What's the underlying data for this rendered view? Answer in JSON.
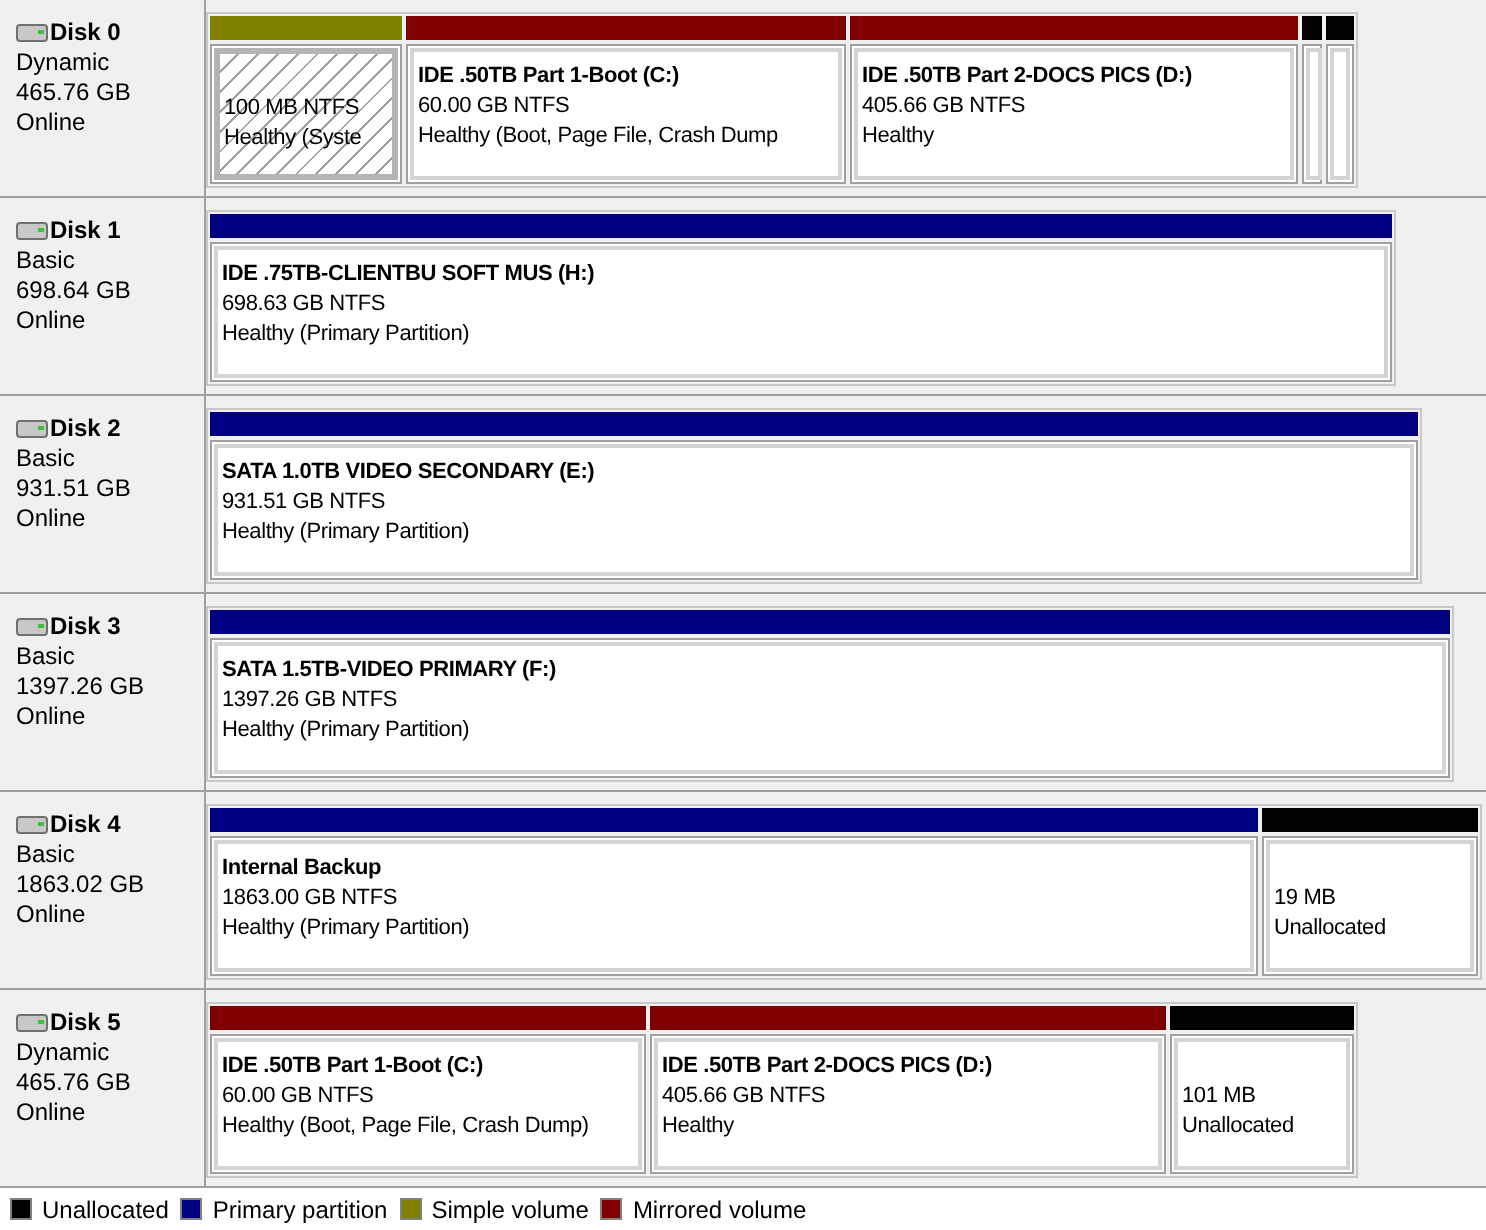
{
  "disks": [
    {
      "name": "Disk 0",
      "type": "Dynamic",
      "size": "465.76 GB",
      "status": "Online",
      "partitions": [
        {
          "kind": "simple",
          "selected": true,
          "lines": [
            "100 MB NTFS",
            "Healthy (Syste"
          ]
        },
        {
          "kind": "mirrored",
          "selected": false,
          "title": "IDE .50TB Part 1-Boot  (C:)",
          "lines": [
            "60.00 GB NTFS",
            "Healthy (Boot, Page File, Crash Dump"
          ]
        },
        {
          "kind": "mirrored",
          "selected": false,
          "title": "IDE .50TB Part 2-DOCS PICS  (D:)",
          "lines": [
            "405.66 GB NTFS",
            "Healthy"
          ]
        },
        {
          "kind": "unallocated",
          "selected": false
        },
        {
          "kind": "unallocated",
          "selected": false
        }
      ]
    },
    {
      "name": "Disk 1",
      "type": "Basic",
      "size": "698.64 GB",
      "status": "Online",
      "partitions": [
        {
          "kind": "primary",
          "selected": false,
          "title": "IDE .75TB-CLIENTBU SOFT MUS  (H:)",
          "lines": [
            "698.63 GB NTFS",
            "Healthy (Primary Partition)"
          ]
        }
      ]
    },
    {
      "name": "Disk 2",
      "type": "Basic",
      "size": "931.51 GB",
      "status": "Online",
      "partitions": [
        {
          "kind": "primary",
          "selected": false,
          "title": "SATA 1.0TB VIDEO SECONDARY  (E:)",
          "lines": [
            "931.51 GB NTFS",
            "Healthy (Primary Partition)"
          ]
        }
      ]
    },
    {
      "name": "Disk 3",
      "type": "Basic",
      "size": "1397.26 GB",
      "status": "Online",
      "partitions": [
        {
          "kind": "primary",
          "selected": false,
          "title": "SATA 1.5TB-VIDEO PRIMARY  (F:)",
          "lines": [
            "1397.26 GB NTFS",
            "Healthy (Primary Partition)"
          ]
        }
      ]
    },
    {
      "name": "Disk 4",
      "type": "Basic",
      "size": "1863.02 GB",
      "status": "Online",
      "partitions": [
        {
          "kind": "primary",
          "selected": false,
          "title": "Internal Backup",
          "lines": [
            "1863.00 GB NTFS",
            "Healthy (Primary Partition)"
          ]
        },
        {
          "kind": "unallocated",
          "selected": false,
          "lines": [
            "19 MB",
            "Unallocated"
          ]
        }
      ]
    },
    {
      "name": "Disk 5",
      "type": "Dynamic",
      "size": "465.76 GB",
      "status": "Online",
      "partitions": [
        {
          "kind": "mirrored",
          "selected": false,
          "title": "IDE .50TB Part 1-Boot  (C:)",
          "lines": [
            "60.00 GB NTFS",
            "Healthy (Boot, Page File, Crash Dump)"
          ]
        },
        {
          "kind": "mirrored",
          "selected": false,
          "title": "IDE .50TB Part 2-DOCS PICS  (D:)",
          "lines": [
            "405.66 GB NTFS",
            "Healthy"
          ]
        },
        {
          "kind": "unallocated",
          "selected": false,
          "lines": [
            "101 MB",
            "Unallocated"
          ]
        }
      ]
    }
  ],
  "legend": [
    {
      "label": "Unallocated",
      "color": "#000000"
    },
    {
      "label": "Primary partition",
      "color": "#000080"
    },
    {
      "label": "Simple volume",
      "color": "#808000"
    },
    {
      "label": "Mirrored volume",
      "color": "#800000"
    }
  ]
}
